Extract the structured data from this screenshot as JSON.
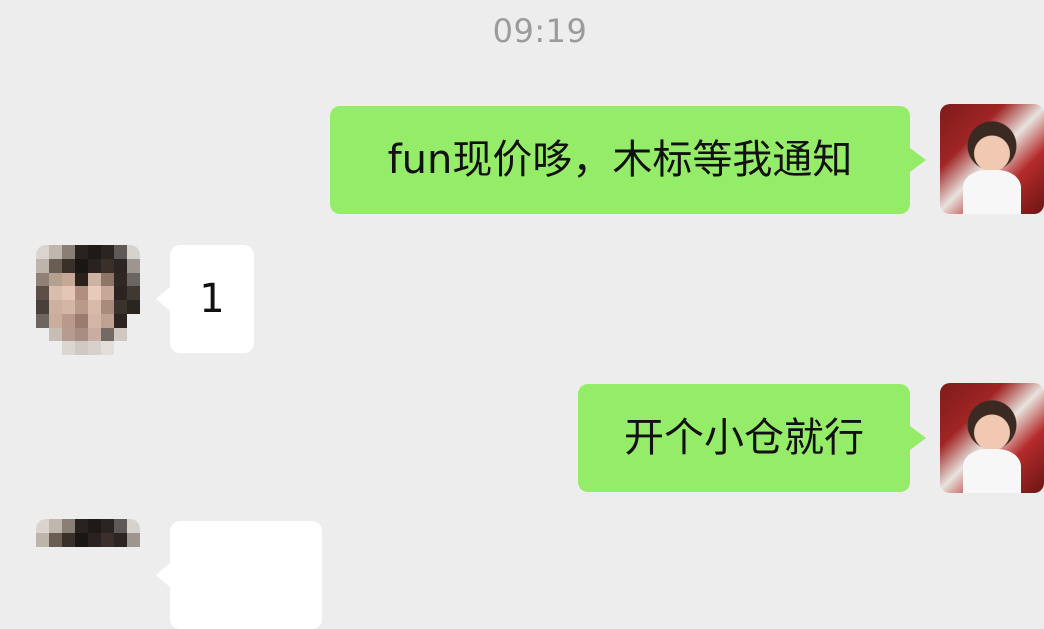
{
  "timestamp": "09:19",
  "messages": [
    {
      "sender": "me",
      "text": "fun现价哆，木标等我通知"
    },
    {
      "sender": "other",
      "text": "1"
    },
    {
      "sender": "me",
      "text": "开个小仓就行"
    },
    {
      "sender": "other",
      "text": ""
    }
  ],
  "colors": {
    "background": "#ededed",
    "outgoing_bubble": "#95ec69",
    "incoming_bubble": "#ffffff",
    "timestamp_text": "#9b9b9b"
  }
}
